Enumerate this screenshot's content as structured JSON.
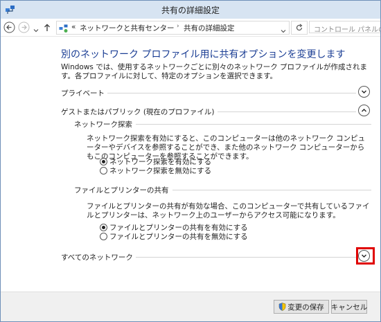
{
  "window": {
    "title": "共有の詳細設定"
  },
  "nav": {
    "breadcrumb_prefix": "«",
    "breadcrumb": [
      "ネットワークと共有センター",
      "共有の詳細設定"
    ],
    "breadcrumb_sep": "›",
    "search_placeholder": "コントロール パネルの検索"
  },
  "main": {
    "heading": "別のネットワーク プロファイル用に共有オプションを変更します",
    "description": "Windows では、使用するネットワークごとに別々のネットワーク プロファイルが作成されます。各プロファイルに対して、特定のオプションを選択できます。",
    "sections": {
      "private": {
        "label": "プライベート",
        "expanded": false
      },
      "guest": {
        "label": "ゲストまたはパブリック (現在のプロファイル)",
        "expanded": true,
        "network_discovery": {
          "label": "ネットワーク探索",
          "text": "ネットワーク探索を有効にすると、このコンピューターは他のネットワーク コンピューターやデバイスを参照することができ、また他のネットワーク コンピューターからもこのコンピューターを参照することができます。",
          "options": [
            {
              "label": "ネットワーク探索を有効にする",
              "selected": true
            },
            {
              "label": "ネットワーク探索を無効にする",
              "selected": false
            }
          ]
        },
        "file_sharing": {
          "label": "ファイルとプリンターの共有",
          "text": "ファイルとプリンターの共有が有効な場合、このコンピューターで共有しているファイルとプリンターは、ネットワーク上のユーザーからアクセス可能になります。",
          "options": [
            {
              "label": "ファイルとプリンターの共有を有効にする",
              "selected": true
            },
            {
              "label": "ファイルとプリンターの共有を無効にする",
              "selected": false
            }
          ]
        }
      },
      "all": {
        "label": "すべてのネットワーク",
        "expanded": false
      }
    }
  },
  "footer": {
    "save_label": "変更の保存",
    "cancel_label": "キャンセル"
  },
  "colors": {
    "heading": "#1b3e94",
    "highlight": "#e00000",
    "titlebar": "#d7e4f2"
  }
}
